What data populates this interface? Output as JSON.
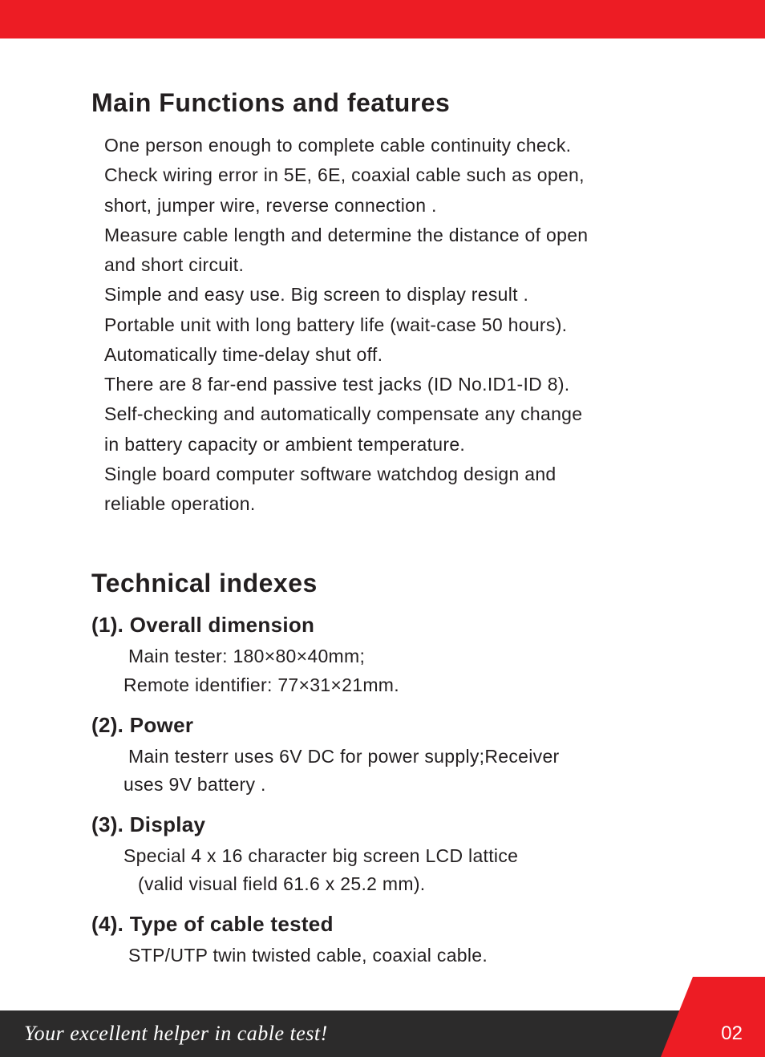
{
  "section1": {
    "title": "Main Functions and features",
    "points": [
      " One person enough to complete cable continuity check.",
      " Check wiring error in 5E, 6E, coaxial cable such as open,",
      "short, jumper wire, reverse connection .",
      " Measure cable length and determine the distance of open",
      "and short circuit.",
      " Simple and easy use. Big screen to display result .",
      " Portable unit with long battery life (wait-case 50 hours).",
      " Automatically time-delay shut off.",
      " There are 8 far-end passive test jacks (ID No.ID1-ID 8).",
      " Self-checking  and automatically compensate any change",
      "in battery capacity or ambient temperature.",
      " Single board computer software watchdog design and",
      "reliable operation."
    ]
  },
  "section2": {
    "title": "Technical indexes",
    "items": [
      {
        "heading": "(1). Overall dimension",
        "lines": [
          " Main tester: 180×80×40mm;",
          "Remote identifier: 77×31×21mm."
        ]
      },
      {
        "heading": "(2). Power",
        "lines": [
          " Main testerr uses 6V DC  for power supply;Receiver",
          "uses 9V battery ."
        ]
      },
      {
        "heading": "(3). Display",
        "lines": [
          "Special 4 x 16 character big screen LCD lattice",
          "  (valid visual field 61.6 x 25.2 mm)."
        ]
      },
      {
        "heading": "(4). Type of cable tested",
        "lines": [
          " STP/UTP twin twisted cable, coaxial cable."
        ]
      }
    ]
  },
  "footer": {
    "tagline": "Your excellent helper in cable test!",
    "page": "02"
  }
}
